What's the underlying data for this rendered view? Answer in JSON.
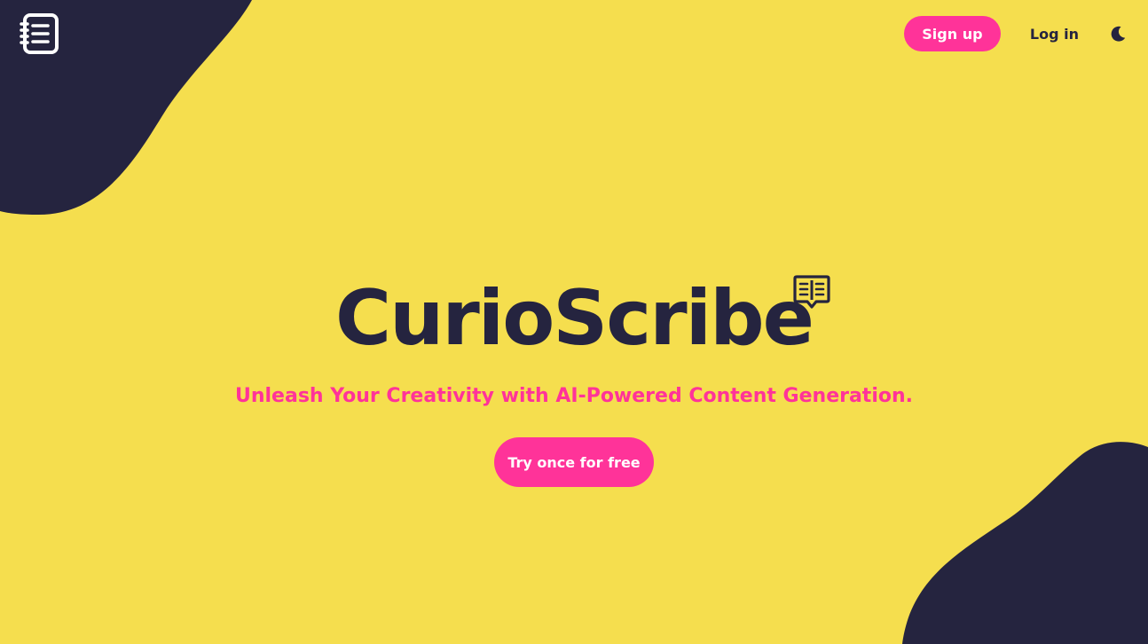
{
  "colors": {
    "background": "#f5de4e",
    "dark": "#25243f",
    "accent": "#ff3399"
  },
  "header": {
    "logo_icon": "notebook-icon",
    "signup_label": "Sign up",
    "login_label": "Log in",
    "theme_icon": "moon-icon"
  },
  "hero": {
    "title": "CurioScribe",
    "title_icon": "open-book-icon",
    "tagline": "Unleash Your Creativity with AI-Powered Content Generation.",
    "cta_label": "Try once for free"
  }
}
